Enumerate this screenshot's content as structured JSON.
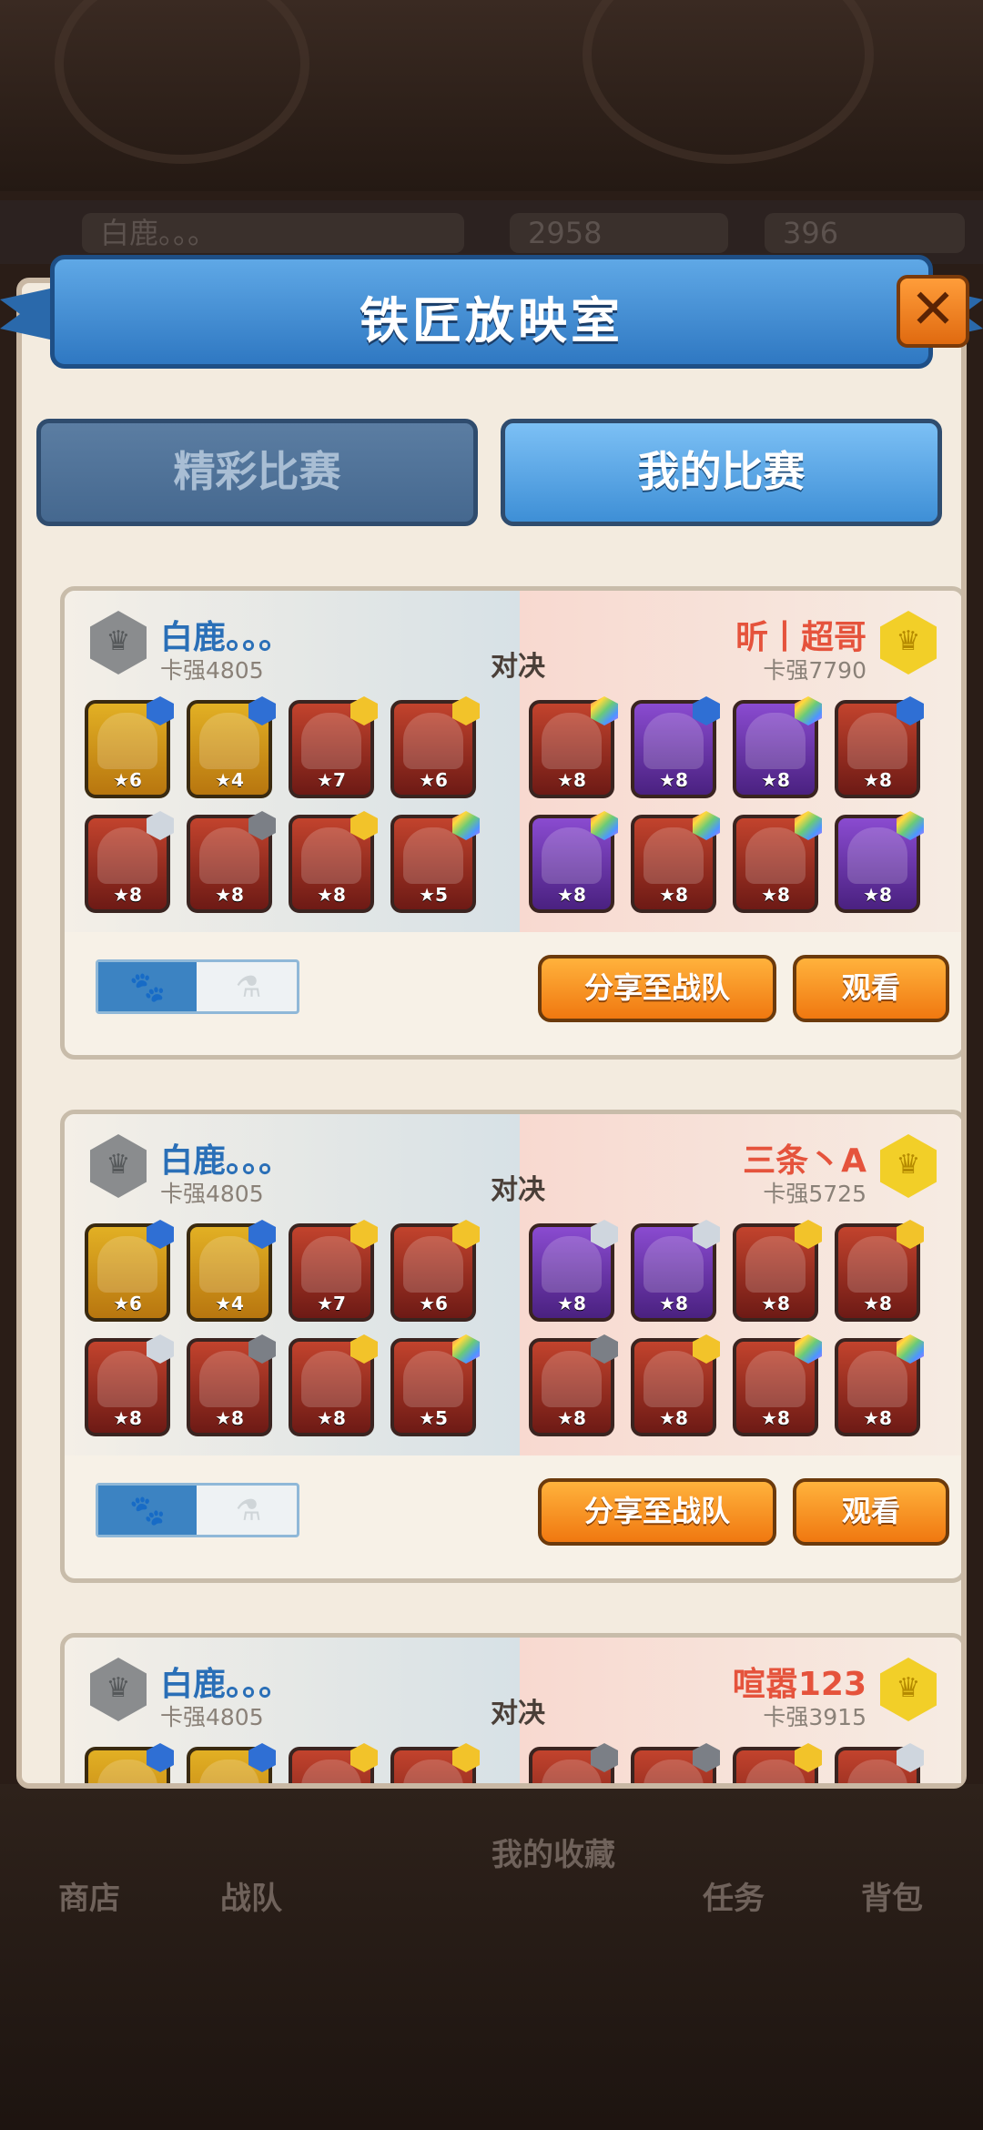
{
  "window_title": "铁匠放映室",
  "close_label": "✕",
  "tabs": [
    {
      "label": "精彩比赛",
      "active": false
    },
    {
      "label": "我的比赛",
      "active": true
    }
  ],
  "top_bar": {
    "player": "白鹿。。。",
    "coins": "2958",
    "gems": "396"
  },
  "bottom_nav": [
    "商店",
    "战队",
    "我的收藏",
    "任务",
    "背包"
  ],
  "vs_label": "对决",
  "share_label": "分享至战队",
  "watch_label": "观看",
  "rank_icon_l": "♛",
  "rank_icon_r": "♛",
  "toggle_paw": "🐾",
  "toggle_flask": "⚗",
  "matches": [
    {
      "p1": {
        "name": "白鹿。。。",
        "score": "卡强4805"
      },
      "p2": {
        "name": "昕丨超哥",
        "score": "卡强7790"
      },
      "p1_units": [
        {
          "star": "★6",
          "frame": "gold",
          "gem": "blue"
        },
        {
          "star": "★4",
          "frame": "gold",
          "gem": "blue"
        },
        {
          "star": "★7",
          "frame": "red",
          "gem": "gold"
        },
        {
          "star": "★6",
          "frame": "red",
          "gem": "gold"
        },
        {
          "star": "★8",
          "frame": "red",
          "gem": "silver"
        },
        {
          "star": "★8",
          "frame": "red",
          "gem": "dark"
        },
        {
          "star": "★8",
          "frame": "red",
          "gem": "gold"
        },
        {
          "star": "★5",
          "frame": "red",
          "gem": "rainbow"
        }
      ],
      "p2_units": [
        {
          "star": "★8",
          "frame": "red",
          "gem": "rainbow"
        },
        {
          "star": "★8",
          "frame": "purple",
          "gem": "blue"
        },
        {
          "star": "★8",
          "frame": "purple",
          "gem": "rainbow"
        },
        {
          "star": "★8",
          "frame": "red",
          "gem": "blue"
        },
        {
          "star": "★8",
          "frame": "purple",
          "gem": "rainbow"
        },
        {
          "star": "★8",
          "frame": "red",
          "gem": "rainbow"
        },
        {
          "star": "★8",
          "frame": "red",
          "gem": "rainbow"
        },
        {
          "star": "★8",
          "frame": "purple",
          "gem": "rainbow"
        }
      ]
    },
    {
      "p1": {
        "name": "白鹿。。。",
        "score": "卡强4805"
      },
      "p2": {
        "name": "三条丶A",
        "score": "卡强5725"
      },
      "p1_units": [
        {
          "star": "★6",
          "frame": "gold",
          "gem": "blue"
        },
        {
          "star": "★4",
          "frame": "gold",
          "gem": "blue"
        },
        {
          "star": "★7",
          "frame": "red",
          "gem": "gold"
        },
        {
          "star": "★6",
          "frame": "red",
          "gem": "gold"
        },
        {
          "star": "★8",
          "frame": "red",
          "gem": "silver"
        },
        {
          "star": "★8",
          "frame": "red",
          "gem": "dark"
        },
        {
          "star": "★8",
          "frame": "red",
          "gem": "gold"
        },
        {
          "star": "★5",
          "frame": "red",
          "gem": "rainbow"
        }
      ],
      "p2_units": [
        {
          "star": "★8",
          "frame": "purple",
          "gem": "silver"
        },
        {
          "star": "★8",
          "frame": "purple",
          "gem": "silver"
        },
        {
          "star": "★8",
          "frame": "red",
          "gem": "gold"
        },
        {
          "star": "★8",
          "frame": "red",
          "gem": "gold"
        },
        {
          "star": "★8",
          "frame": "red",
          "gem": "dark"
        },
        {
          "star": "★8",
          "frame": "red",
          "gem": "gold"
        },
        {
          "star": "★8",
          "frame": "red",
          "gem": "rainbow"
        },
        {
          "star": "★8",
          "frame": "red",
          "gem": "rainbow"
        }
      ]
    },
    {
      "p1": {
        "name": "白鹿。。。",
        "score": "卡强4805"
      },
      "p2": {
        "name": "喧嚣123",
        "score": "卡强3915"
      },
      "p1_units": [
        {
          "star": "",
          "frame": "gold",
          "gem": "blue"
        },
        {
          "star": "",
          "frame": "gold",
          "gem": "blue"
        },
        {
          "star": "",
          "frame": "red",
          "gem": "gold"
        },
        {
          "star": "",
          "frame": "red",
          "gem": "gold"
        }
      ],
      "p2_units": [
        {
          "star": "",
          "frame": "red",
          "gem": "dark"
        },
        {
          "star": "",
          "frame": "red",
          "gem": "dark"
        },
        {
          "star": "",
          "frame": "red",
          "gem": "gold"
        },
        {
          "star": "",
          "frame": "red",
          "gem": "silver"
        }
      ]
    }
  ]
}
